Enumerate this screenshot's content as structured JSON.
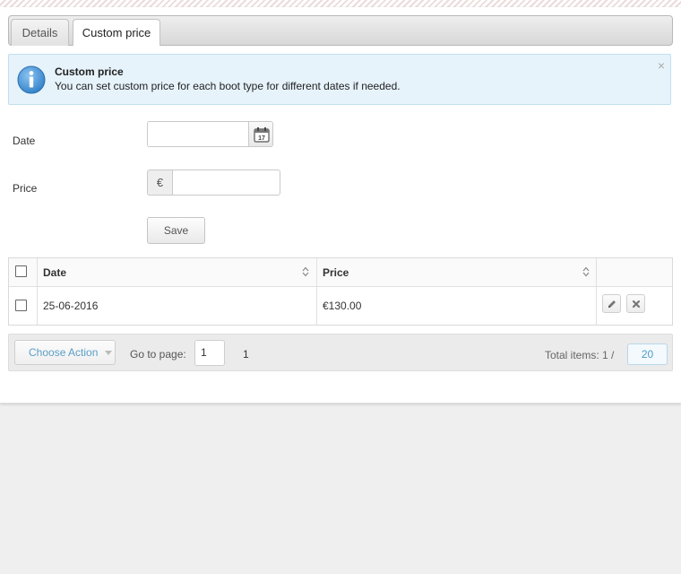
{
  "tabs": [
    {
      "label": "Details",
      "active": false
    },
    {
      "label": "Custom price",
      "active": true
    }
  ],
  "alert": {
    "title": "Custom price",
    "message": "You can set custom price for each boot type for different dates if needed.",
    "close_glyph": "×",
    "icon": "info-icon"
  },
  "form": {
    "date_label": "Date",
    "date_value": "",
    "price_label": "Price",
    "currency_symbol": "€",
    "price_value": "",
    "calendar_day": "17",
    "save_label": "Save"
  },
  "table": {
    "columns": [
      "Date",
      "Price"
    ],
    "rows": [
      {
        "date": "25-06-2016",
        "price": "€130.00"
      }
    ]
  },
  "pager": {
    "choose_action_label": "Choose Action",
    "goto_label": "Go to page:",
    "page_value": "1",
    "page_count": "1",
    "total_label": "Total items: 1 /",
    "per_page": "20"
  },
  "colors": {
    "alert_bg": "#e6f3fb",
    "link_blue": "#5a9ec8",
    "info_icon_blue": "#3f8fd6"
  }
}
